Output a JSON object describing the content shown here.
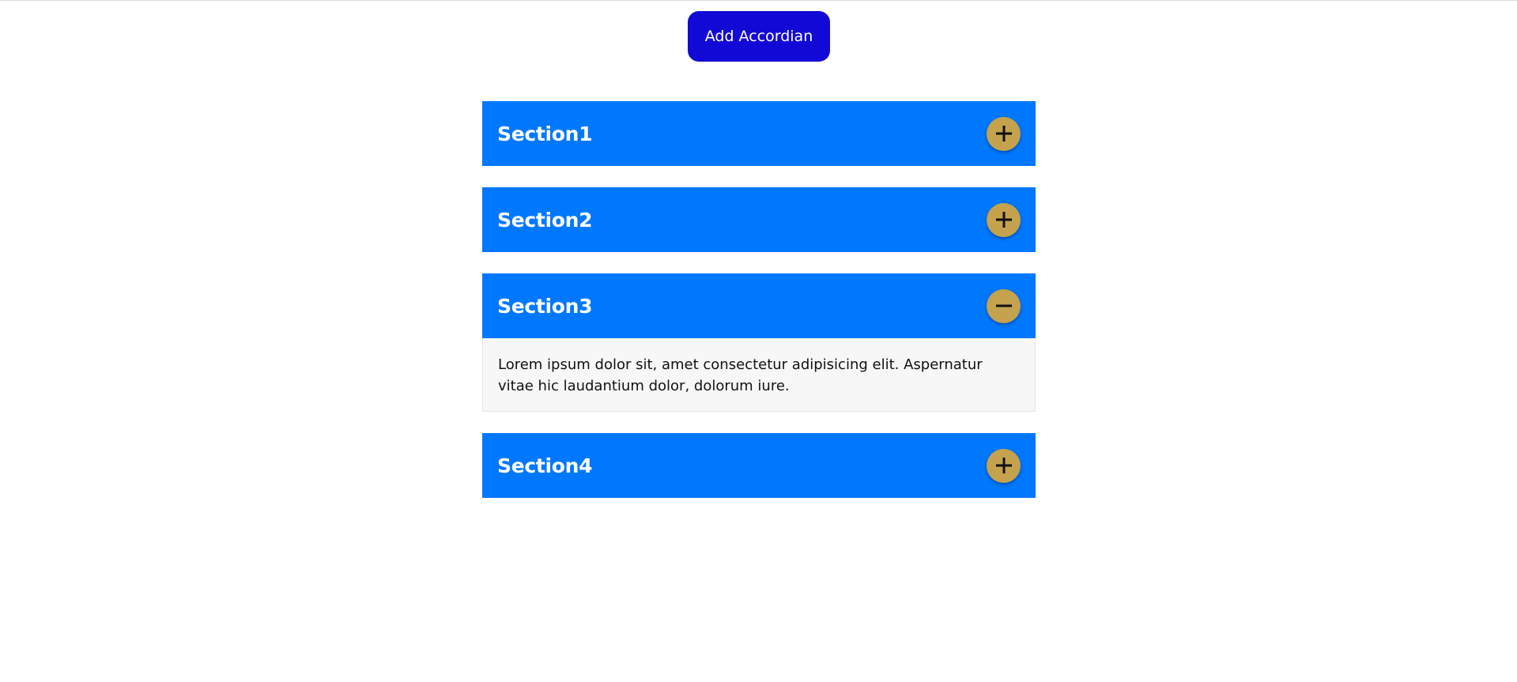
{
  "toolbar": {
    "add_label": "Add Accordian"
  },
  "colors": {
    "add_button": "#1309d6",
    "header": "#0078fe",
    "toggle": "#c5a24d",
    "body_bg": "#f7f7f7"
  },
  "accordion": {
    "items": [
      {
        "title": "Section1",
        "expanded": false,
        "toggle_icon": "plus-icon"
      },
      {
        "title": "Section2",
        "expanded": false,
        "toggle_icon": "plus-icon"
      },
      {
        "title": "Section3",
        "expanded": true,
        "toggle_icon": "minus-icon",
        "body": "Lorem ipsum dolor sit, amet consectetur adipisicing elit. Aspernatur vitae hic laudantium dolor, dolorum iure."
      },
      {
        "title": "Section4",
        "expanded": false,
        "toggle_icon": "plus-icon"
      }
    ]
  }
}
